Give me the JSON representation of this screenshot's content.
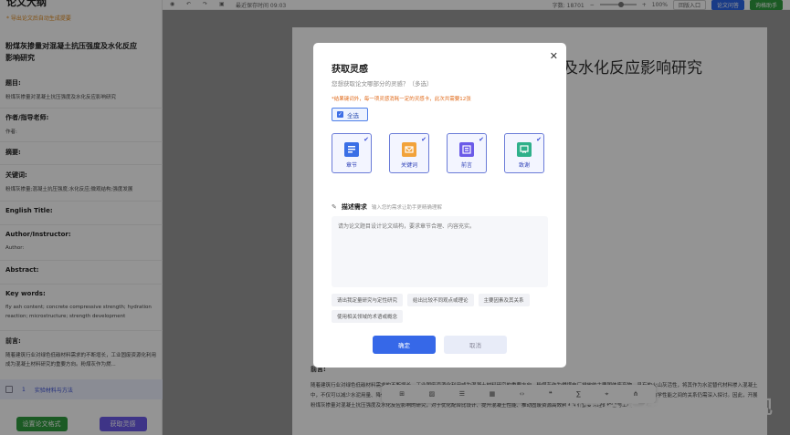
{
  "sidebar": {
    "title": "论文大纲",
    "hint": "* 导出论文后自动生成提要",
    "doc_title": "粉煤灰掺量对混凝土抗压强度及水化反应影响研究",
    "sections": [
      {
        "label": "题目:",
        "value": "粉煤灰掺量对混凝土抗压强度及水化反应影响研究"
      },
      {
        "label": "作者/指导老师:",
        "value": "作者:"
      },
      {
        "label": "摘要:",
        "value": ""
      },
      {
        "label": "关键词:",
        "value": "粉煤灰掺量;混凝土抗压强度;水化反应;微观结构;强度发展"
      },
      {
        "label": "English Title:",
        "value": ""
      },
      {
        "label": "Author/Instructor:",
        "value": "Author:"
      },
      {
        "label": "Abstract:",
        "value": ""
      },
      {
        "label": "Key words:",
        "value": "fly ash content; concrete compressive strength; hydration reaction; microstructure; strength development"
      },
      {
        "label": "前言:",
        "value": "随着建筑行业对绿色低碳材料需求的不断增长，工业固废资源化利用成为混凝土材料研究的重要方向。粉煤灰作为燃..."
      }
    ],
    "chapter": {
      "num": "1",
      "name": "实验材料与方法"
    },
    "btn_format": "设置论文格式",
    "btn_inspire": "获取灵感"
  },
  "topbar": {
    "save_status": "最近保存时间 09:03",
    "word_count": "字数: 18701",
    "zoom": "100%",
    "btn_paste": "回版入口",
    "btn_qa": "论文问答",
    "btn_assistant": "询格助手"
  },
  "document": {
    "heading": "及水化反应影响研究",
    "body_label": "前言:",
    "body_text": "随着建筑行业对绿色低碳材料需求的不断增长，工业固废资源化利用成为混凝土材料研究的重要方向。粉煤灰作为燃煤电厂排放的主要固体废弃物，具有的火山灰活性，将其作为水泥替代材料掺入混凝土中，不仅可以减少水泥用量、降低碳排放，还能改善混凝土的工作性能和耐久性。然而，粉煤灰掺量对混凝土早期强度的影响较为显著，其水化反应机理与力学性能之间的关系仍需深入探讨。因此，开展粉煤灰掺量对混凝土抗压强度及水化反应影响的研究，对于优化配合比设计、提升混凝土性能、推动固废资源高效利用具有重要的理论价值与工程",
    "watermark": "掘金技术社区 @ AI发现"
  },
  "modal": {
    "title": "获取灵感",
    "subtitle": "您想获取论文哪部分的灵感？（多选）",
    "warning": "*结果键词外，每一项灵感消耗一定的灵感卡，此次共需要12张",
    "select_all": "全选",
    "cards": [
      {
        "label": "章节",
        "icon": "chapter-icon",
        "color": "#3a6fe6"
      },
      {
        "label": "关键词",
        "icon": "keyword-icon",
        "color": "#f2a23a"
      },
      {
        "label": "前言",
        "icon": "preface-icon",
        "color": "#6b5be8"
      },
      {
        "label": "致谢",
        "icon": "thanks-icon",
        "color": "#2fb08a"
      }
    ],
    "desc_title": "描述需求",
    "desc_hint": "输入您的需求让助手更精确理解",
    "desc_placeholder": "请为论文题目设计论文结构，要求章节合理、内容充实。",
    "chips": [
      "请出我定量研究与定性研究",
      "给出比较不同观点或理论",
      "主要因素及其关系",
      "使用相关领域的术语或概念"
    ],
    "ok": "确定",
    "cancel": "取消"
  }
}
